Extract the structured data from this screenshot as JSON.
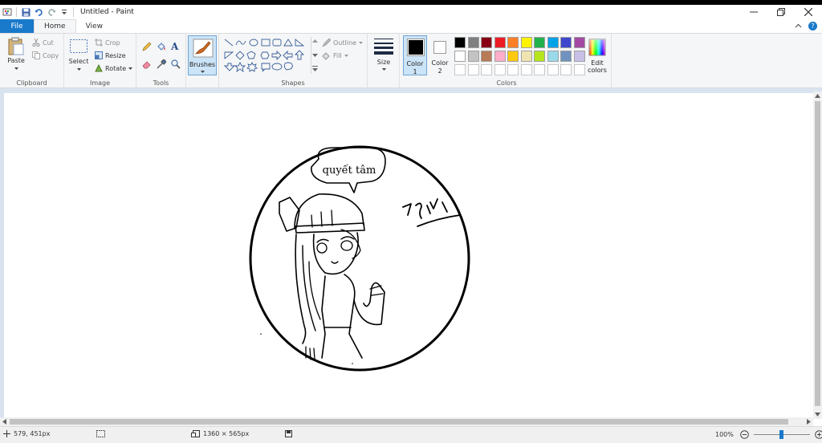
{
  "window": {
    "title": "Untitled - Paint"
  },
  "tabs": {
    "file": "File",
    "home": "Home",
    "view": "View"
  },
  "clipboard": {
    "paste": "Paste",
    "cut": "Cut",
    "copy": "Copy",
    "label": "Clipboard"
  },
  "image": {
    "select": "Select",
    "crop": "Crop",
    "resize": "Resize",
    "rotate": "Rotate",
    "label": "Image"
  },
  "tools": {
    "label": "Tools"
  },
  "brushes": {
    "label": "Brushes"
  },
  "shapes": {
    "outline": "Outline",
    "fill": "Fill",
    "label": "Shapes"
  },
  "size": {
    "label": "Size"
  },
  "color1": {
    "label": "Color",
    "num": "1",
    "color": "#000000"
  },
  "color2": {
    "label": "Color",
    "num": "2",
    "color": "#ffffff"
  },
  "colors": {
    "label": "Colors",
    "edit": "Edit colors",
    "row1": [
      "#000000",
      "#7f7f7f",
      "#880015",
      "#ed1c24",
      "#ff7f27",
      "#fff200",
      "#22b14c",
      "#00a2e8",
      "#3f48cc",
      "#a349a4"
    ],
    "row2": [
      "#ffffff",
      "#c3c3c3",
      "#b97a57",
      "#ffaec9",
      "#ffc90e",
      "#efe4b0",
      "#b5e61d",
      "#99d9ea",
      "#7092be",
      "#c8bfe7"
    ],
    "row3": [
      "#ffffff",
      "#ffffff",
      "#ffffff",
      "#ffffff",
      "#ffffff",
      "#ffffff",
      "#ffffff",
      "#ffffff",
      "#ffffff",
      "#ffffff"
    ]
  },
  "drawing": {
    "speech": "quyết tâm"
  },
  "status": {
    "cursor": "579, 451px",
    "dimensions": "1360 × 565px",
    "zoom": "100%",
    "zoom_level": 0.5
  }
}
